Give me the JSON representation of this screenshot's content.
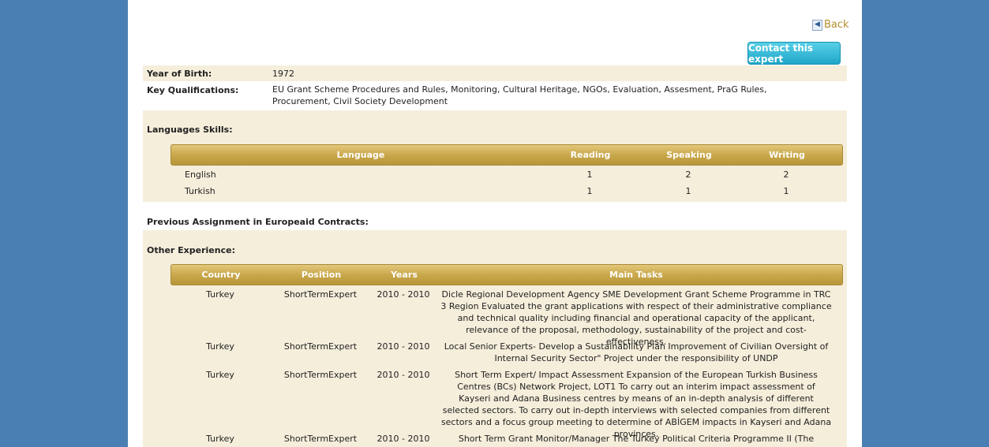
{
  "nav": {
    "back_label": "Back",
    "contact_label": "Contact this expert"
  },
  "profile": {
    "year_of_birth_label": "Year of Birth:",
    "year_of_birth": "1972",
    "key_qualifications_label": "Key Qualifications:",
    "key_qualifications": "EU Grant Scheme Procedures and Rules, Monitoring, Cultural Heritage, NGOs, Evaluation, Assesment, PraG Rules, Procurement, Civil Society Development"
  },
  "languages": {
    "section_label": "Languages Skills:",
    "headers": [
      "Language",
      "Reading",
      "Speaking",
      "Writing"
    ],
    "rows": [
      {
        "language": "English",
        "reading": "1",
        "speaking": "2",
        "writing": "2"
      },
      {
        "language": "Turkish",
        "reading": "1",
        "speaking": "1",
        "writing": "1"
      }
    ]
  },
  "previous_assignment": {
    "section_label": "Previous Assignment in Europeaid Contracts:"
  },
  "other_experience": {
    "section_label": "Other Experience:",
    "headers": [
      "Country",
      "Position",
      "Years",
      "Main Tasks"
    ],
    "rows": [
      {
        "country": "Turkey",
        "position": "ShortTermExpert",
        "years": "2010 - 2010",
        "tasks": "Dicle Regional Development Agency SME Development Grant Scheme Programme in TRC 3 Region Evaluated the grant applications with respect of their administrative compliance and technical quality including financial and operational capacity of the applicant, relevance of the proposal, methodology, sustainability of the project and cost-effectiveness."
      },
      {
        "country": "Turkey",
        "position": "ShortTermExpert",
        "years": "2010 - 2010",
        "tasks": "Local Senior Experts- Develop a Sustainability Plan Improvement of Civilian Oversight of Internal Security Sector\" Project under the responsibility of UNDP"
      },
      {
        "country": "Turkey",
        "position": "ShortTermExpert",
        "years": "2010 - 2010",
        "tasks": "Short Term Expert/ Impact Assessment Expansion of the European Turkish Business Centres (BCs) Network Project, LOT1 To carry out an interim impact assessment of Kayseri and Adana Business centres by means of an in-depth analysis of different selected sectors. To carry out in-depth interviews with selected companies from different sectors and a focus group meeting to determine of ABİGEM impacts in Kayseri and Adana provinces."
      },
      {
        "country": "Turkey",
        "position": "ShortTermExpert",
        "years": "2010 - 2010",
        "tasks": "Short Term Grant Monitor/Manager The Turkey Political Criteria Programme II (The Programme is funded"
      }
    ]
  },
  "icons": {
    "back": "back-arrow-icon"
  },
  "colors": {
    "background": "#4a7fb3",
    "panel": "#ffffff",
    "beige_row": "#f5eedb",
    "header_gold": "#c9a84c",
    "button_cyan": "#3bbcd8",
    "link_gold": "#b58e2c"
  }
}
